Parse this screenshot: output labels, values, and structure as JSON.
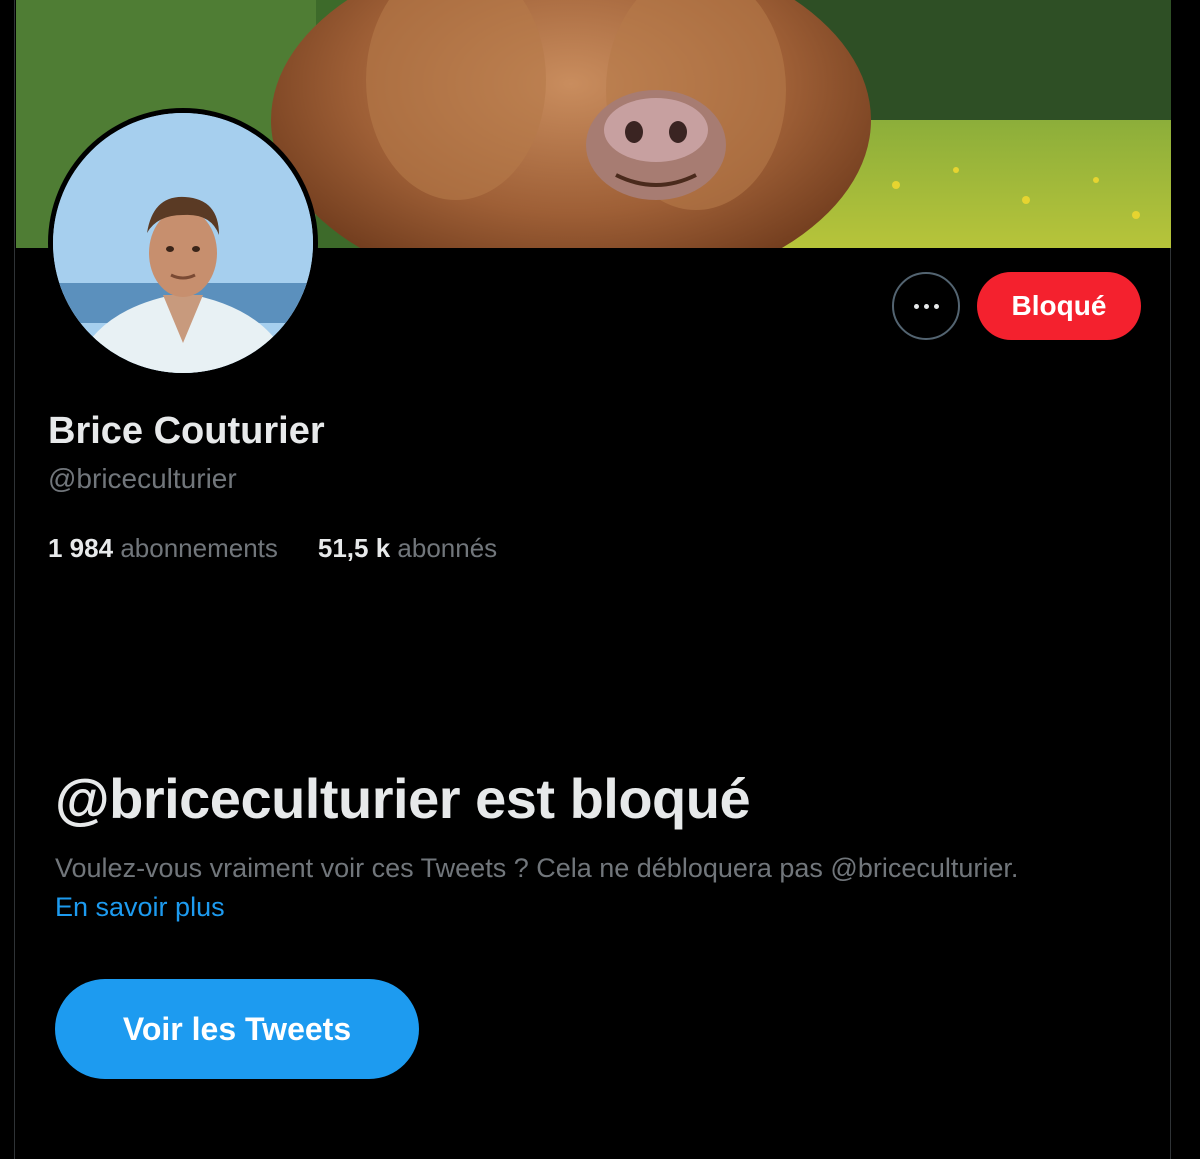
{
  "profile": {
    "display_name": "Brice Couturier",
    "handle": "@briceculturier",
    "following_count": "1 984",
    "following_label": "abonnements",
    "followers_count": "51,5 k",
    "followers_label": "abonnés"
  },
  "actions": {
    "more_icon": "more-horizontal-icon",
    "blocked_label": "Bloqué"
  },
  "blocked_notice": {
    "title": "@briceculturier est bloqué",
    "description": "Voulez-vous vraiment voir ces Tweets ? Cela ne débloquera pas @briceculturier.",
    "learn_more": "En savoir plus",
    "view_tweets_label": "Voir les Tweets"
  },
  "colors": {
    "background": "#000000",
    "blocked_red": "#f4212e",
    "accent_blue": "#1d9bf0",
    "muted_text": "#71767b",
    "primary_text": "#e7e9ea"
  }
}
